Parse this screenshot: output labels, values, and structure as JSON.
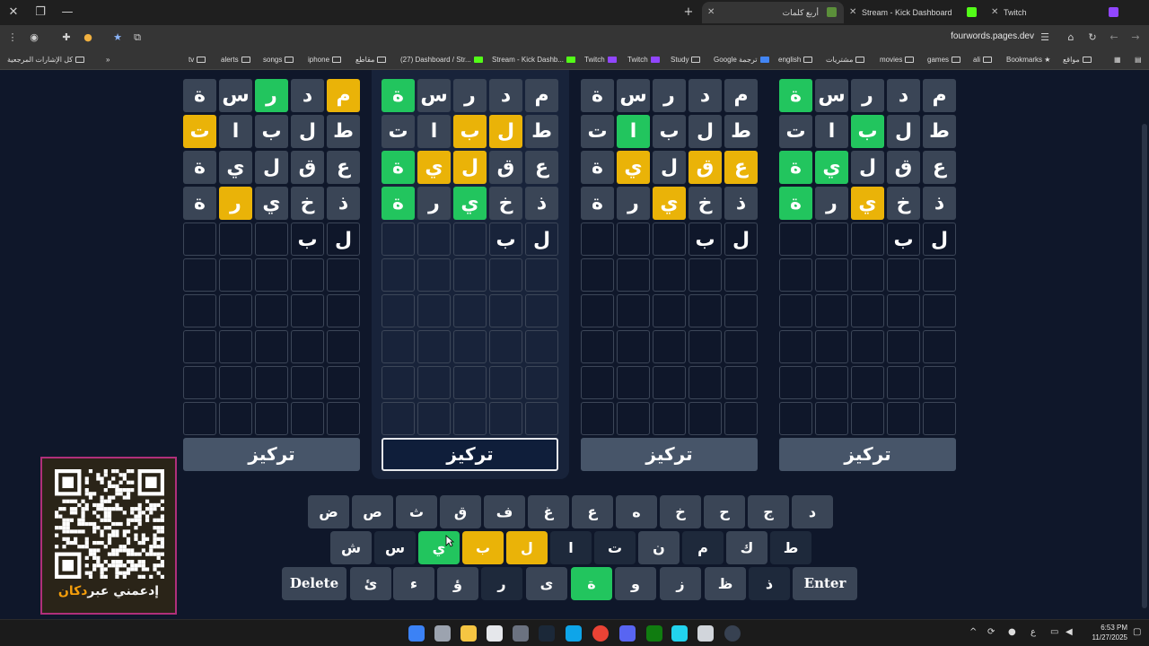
{
  "tabs": [
    {
      "title": "أربع كلمات",
      "active": true
    },
    {
      "title": "Stream - Kick Dashboard",
      "active": false
    },
    {
      "title": "Twitch",
      "active": false
    }
  ],
  "address": {
    "url": "fourwords.pages.dev"
  },
  "bookmarks": [
    "كل الإشارات المرجعية",
    "tv",
    "alerts",
    "songs",
    "iphone",
    "مقاطع",
    "(27) Dashboard / Str...",
    "Stream - Kick Dashb...",
    "Twitch",
    "Twitch",
    "Study",
    "Google ترجمة",
    "english",
    "مشتريات",
    "movies",
    "games",
    "ali",
    "Bookmarks",
    "مواقع"
  ],
  "boards": [
    {
      "rows": [
        [
          [
            "م",
            "yellow"
          ],
          [
            "د",
            "gray"
          ],
          [
            "ر",
            "green"
          ],
          [
            "س",
            "gray"
          ],
          [
            "ة",
            "gray"
          ]
        ],
        [
          [
            "ط",
            "gray"
          ],
          [
            "ل",
            "gray"
          ],
          [
            "ب",
            "gray"
          ],
          [
            "ا",
            "gray"
          ],
          [
            "ت",
            "yellow"
          ]
        ],
        [
          [
            "ع",
            "gray"
          ],
          [
            "ق",
            "gray"
          ],
          [
            "ل",
            "gray"
          ],
          [
            "ي",
            "gray"
          ],
          [
            "ة",
            "gray"
          ]
        ],
        [
          [
            "ذ",
            "gray"
          ],
          [
            "خ",
            "gray"
          ],
          [
            "ي",
            "gray"
          ],
          [
            "ر",
            "yellow"
          ],
          [
            "ة",
            "gray"
          ]
        ],
        [
          [
            "ل",
            "typed"
          ],
          [
            "ب",
            "typed"
          ],
          [
            "",
            "empty"
          ],
          [
            "",
            "empty"
          ],
          [
            "",
            "empty"
          ]
        ]
      ],
      "focus_label": "تركيز",
      "selected": false
    },
    {
      "rows": [
        [
          [
            "م",
            "gray"
          ],
          [
            "د",
            "gray"
          ],
          [
            "ر",
            "gray"
          ],
          [
            "س",
            "gray"
          ],
          [
            "ة",
            "green"
          ]
        ],
        [
          [
            "ط",
            "gray"
          ],
          [
            "ل",
            "yellow"
          ],
          [
            "ب",
            "yellow"
          ],
          [
            "ا",
            "gray"
          ],
          [
            "ت",
            "gray"
          ]
        ],
        [
          [
            "ع",
            "gray"
          ],
          [
            "ق",
            "gray"
          ],
          [
            "ل",
            "yellow"
          ],
          [
            "ي",
            "yellow"
          ],
          [
            "ة",
            "green"
          ]
        ],
        [
          [
            "ذ",
            "gray"
          ],
          [
            "خ",
            "gray"
          ],
          [
            "ي",
            "green"
          ],
          [
            "ر",
            "gray"
          ],
          [
            "ة",
            "green"
          ]
        ],
        [
          [
            "ل",
            "typed"
          ],
          [
            "ب",
            "typed"
          ],
          [
            "",
            "empty"
          ],
          [
            "",
            "empty"
          ],
          [
            "",
            "empty"
          ]
        ]
      ],
      "focus_label": "تركيز",
      "selected": true
    },
    {
      "rows": [
        [
          [
            "م",
            "gray"
          ],
          [
            "د",
            "gray"
          ],
          [
            "ر",
            "gray"
          ],
          [
            "س",
            "gray"
          ],
          [
            "ة",
            "gray"
          ]
        ],
        [
          [
            "ط",
            "gray"
          ],
          [
            "ل",
            "gray"
          ],
          [
            "ب",
            "gray"
          ],
          [
            "ا",
            "green"
          ],
          [
            "ت",
            "gray"
          ]
        ],
        [
          [
            "ع",
            "yellow"
          ],
          [
            "ق",
            "yellow"
          ],
          [
            "ل",
            "gray"
          ],
          [
            "ي",
            "yellow"
          ],
          [
            "ة",
            "gray"
          ]
        ],
        [
          [
            "ذ",
            "gray"
          ],
          [
            "خ",
            "gray"
          ],
          [
            "ي",
            "yellow"
          ],
          [
            "ر",
            "gray"
          ],
          [
            "ة",
            "gray"
          ]
        ],
        [
          [
            "ل",
            "typed"
          ],
          [
            "ب",
            "typed"
          ],
          [
            "",
            "empty"
          ],
          [
            "",
            "empty"
          ],
          [
            "",
            "empty"
          ]
        ]
      ],
      "focus_label": "تركيز",
      "selected": false
    },
    {
      "rows": [
        [
          [
            "م",
            "gray"
          ],
          [
            "د",
            "gray"
          ],
          [
            "ر",
            "gray"
          ],
          [
            "س",
            "gray"
          ],
          [
            "ة",
            "green"
          ]
        ],
        [
          [
            "ط",
            "gray"
          ],
          [
            "ل",
            "gray"
          ],
          [
            "ب",
            "green"
          ],
          [
            "ا",
            "gray"
          ],
          [
            "ت",
            "gray"
          ]
        ],
        [
          [
            "ع",
            "gray"
          ],
          [
            "ق",
            "gray"
          ],
          [
            "ل",
            "gray"
          ],
          [
            "ي",
            "green"
          ],
          [
            "ة",
            "green"
          ]
        ],
        [
          [
            "ذ",
            "gray"
          ],
          [
            "خ",
            "gray"
          ],
          [
            "ي",
            "yellow"
          ],
          [
            "ر",
            "gray"
          ],
          [
            "ة",
            "green"
          ]
        ],
        [
          [
            "ل",
            "typed"
          ],
          [
            "ب",
            "typed"
          ],
          [
            "",
            "empty"
          ],
          [
            "",
            "empty"
          ],
          [
            "",
            "empty"
          ]
        ]
      ],
      "focus_label": "تركيز",
      "selected": false
    }
  ],
  "keyboard": {
    "row1": [
      [
        "د",
        "gray"
      ],
      [
        "ج",
        "gray"
      ],
      [
        "ح",
        "gray"
      ],
      [
        "خ",
        "gray"
      ],
      [
        "ه",
        "gray"
      ],
      [
        "ع",
        "gray"
      ],
      [
        "غ",
        "gray"
      ],
      [
        "ف",
        "gray"
      ],
      [
        "ق",
        "gray"
      ],
      [
        "ث",
        "gray"
      ],
      [
        "ص",
        "gray"
      ],
      [
        "ض",
        "gray"
      ]
    ],
    "row2": [
      [
        "ط",
        "dark"
      ],
      [
        "ك",
        "gray"
      ],
      [
        "م",
        "dark"
      ],
      [
        "ن",
        "gray"
      ],
      [
        "ت",
        "dark"
      ],
      [
        "ا",
        "dark"
      ],
      [
        "ل",
        "yellow"
      ],
      [
        "ب",
        "yellow"
      ],
      [
        "ي",
        "green"
      ],
      [
        "س",
        "dark"
      ],
      [
        "ش",
        "gray"
      ]
    ],
    "row3": [
      [
        "Enter",
        "gray"
      ],
      [
        "ذ",
        "dark"
      ],
      [
        "ظ",
        "gray"
      ],
      [
        "ز",
        "gray"
      ],
      [
        "و",
        "gray"
      ],
      [
        "ة",
        "green"
      ],
      [
        "ى",
        "gray"
      ],
      [
        "ر",
        "dark"
      ],
      [
        "ؤ",
        "gray"
      ],
      [
        "ء",
        "gray"
      ],
      [
        "ئ",
        "gray"
      ],
      [
        "Delete",
        "gray"
      ]
    ]
  },
  "support_card": {
    "caption_plain": "إدعمني عبر",
    "caption_brand": "دكان"
  },
  "taskbar": {
    "time": "6:53 PM",
    "date": "11/27/2025",
    "lang": "ع"
  }
}
